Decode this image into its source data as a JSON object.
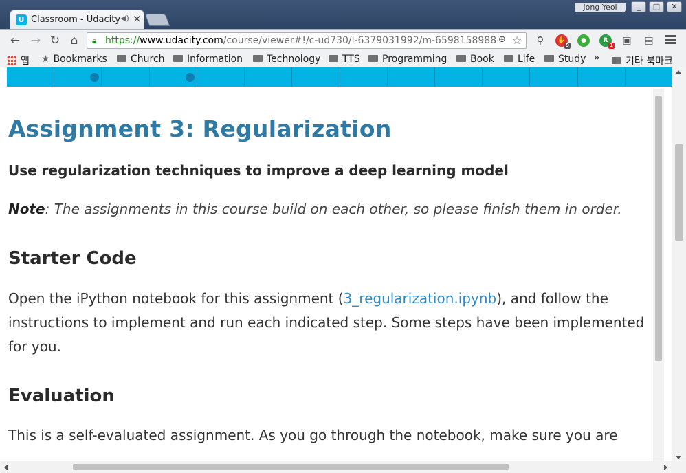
{
  "browser": {
    "tab_title": "Classroom - Udacity",
    "profile_name": "Jong Yeol",
    "window_buttons": [
      "_",
      "□",
      "✕"
    ],
    "url": {
      "scheme": "https://",
      "host": "www.udacity.com",
      "path": "/course/viewer#!/c-ud730/l-6379031992/m-6598158988"
    },
    "extensions": [
      {
        "name": "adblock-icon",
        "badge": "9",
        "color": "#d33"
      },
      {
        "name": "evernote-icon",
        "badge": "",
        "color": "#3cae3c"
      },
      {
        "name": "readability-icon",
        "badge": "1",
        "color": "#2a9d42"
      }
    ]
  },
  "bookmarks": {
    "apps_label": "앱",
    "items": [
      "Bookmarks",
      "Church",
      "Information",
      "Technology",
      "TTS",
      "Programming",
      "Book",
      "Life",
      "Study"
    ],
    "overflow": "»",
    "other_label": "기타 북마크"
  },
  "progress": {
    "segment_count": 14,
    "completed_dots": [
      1,
      3
    ],
    "color": "#02b3e4"
  },
  "article": {
    "title": "Assignment 3: Regularization",
    "subtitle": "Use regularization techniques to improve a deep learning model",
    "note_label": "Note",
    "note_text": ": The assignments in this course build on each other, so please finish them in order.",
    "sections": [
      {
        "heading": "Starter Code",
        "text_before": "Open the iPython notebook for this assignment (",
        "link_text": "3_regularization.ipynb",
        "text_after": "), and follow the instructions to implement and run each indicated step. Some steps have been implemented for you."
      },
      {
        "heading": "Evaluation",
        "text": "This is a self-evaluated assignment. As you go through the notebook, make sure you are"
      }
    ]
  }
}
